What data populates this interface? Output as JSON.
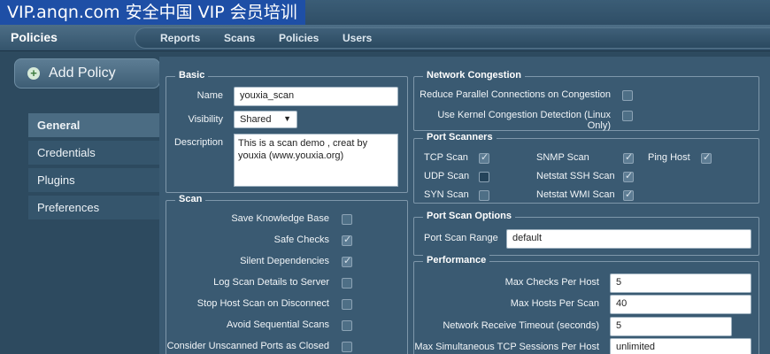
{
  "watermark": "VIP.anqn.com 安全中国 VIP 会员培训",
  "header": {
    "section_title": "Policies",
    "tabs": [
      "Reports",
      "Scans",
      "Policies",
      "Users"
    ]
  },
  "sidebar": {
    "add_policy": "Add Policy",
    "items": [
      "General",
      "Credentials",
      "Plugins",
      "Preferences"
    ],
    "active": "General"
  },
  "basic": {
    "legend": "Basic",
    "name_label": "Name",
    "name_value": "youxia_scan",
    "visibility_label": "Visibility",
    "visibility_value": "Shared",
    "description_label": "Description",
    "description_value": "This is a scan demo , creat by youxia (www.youxia.org)"
  },
  "scan": {
    "legend": "Scan",
    "options": [
      {
        "label": "Save Knowledge Base",
        "checked": false
      },
      {
        "label": "Safe Checks",
        "checked": true
      },
      {
        "label": "Silent Dependencies",
        "checked": true
      },
      {
        "label": "Log Scan Details to Server",
        "checked": false
      },
      {
        "label": "Stop Host Scan on Disconnect",
        "checked": false
      },
      {
        "label": "Avoid Sequential Scans",
        "checked": false
      },
      {
        "label": "Consider Unscanned Ports as Closed",
        "checked": false
      }
    ]
  },
  "network_congestion": {
    "legend": "Network Congestion",
    "options": [
      {
        "label": "Reduce Parallel Connections on Congestion",
        "checked": false
      },
      {
        "label": "Use Kernel Congestion Detection (Linux Only)",
        "checked": false
      }
    ]
  },
  "port_scanners": {
    "legend": "Port Scanners",
    "items": [
      {
        "label": "TCP Scan",
        "checked": true
      },
      {
        "label": "UDP Scan",
        "checked": false
      },
      {
        "label": "SYN Scan",
        "checked": false
      },
      {
        "label": "SNMP Scan",
        "checked": true
      },
      {
        "label": "Netstat SSH Scan",
        "checked": true
      },
      {
        "label": "Netstat WMI Scan",
        "checked": true
      },
      {
        "label": "Ping Host",
        "checked": true
      }
    ]
  },
  "port_scan_options": {
    "legend": "Port Scan Options",
    "range_label": "Port Scan Range",
    "range_value": "default"
  },
  "performance": {
    "legend": "Performance",
    "fields": [
      {
        "label": "Max Checks Per Host",
        "value": "5"
      },
      {
        "label": "Max Hosts Per Scan",
        "value": "40"
      },
      {
        "label": "Network Receive Timeout (seconds)",
        "value": "5"
      },
      {
        "label": "Max Simultaneous TCP Sessions Per Host",
        "value": "unlimited"
      }
    ]
  }
}
